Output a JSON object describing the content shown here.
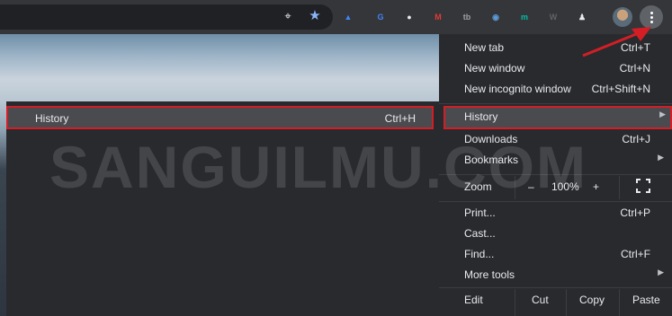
{
  "toolbar": {
    "location_icon": "location-target-icon",
    "bookmark_icon": "star-icon",
    "extensions": [
      {
        "name": "extension-arrow-up-icon",
        "glyph": "▲",
        "color": "#4285f4"
      },
      {
        "name": "extension-translate-icon",
        "glyph": "G",
        "color": "#4285f4"
      },
      {
        "name": "extension-globe-icon",
        "glyph": "●",
        "color": "#e8eaed"
      },
      {
        "name": "extension-m-red-icon",
        "glyph": "M",
        "color": "#e53935"
      },
      {
        "name": "extension-tb-icon",
        "glyph": "tb",
        "color": "#9aa0a6"
      },
      {
        "name": "extension-camera-lens-icon",
        "glyph": "◉",
        "color": "#5b9bd5"
      },
      {
        "name": "extension-m-teal-icon",
        "glyph": "m",
        "color": "#00bfa5"
      },
      {
        "name": "extension-wordpress-icon",
        "glyph": "W",
        "color": "#5f6368"
      },
      {
        "name": "extension-person-icon",
        "glyph": "♟",
        "color": "#e8eaed"
      }
    ],
    "menu_icon": "three-dots-vertical-icon"
  },
  "submenu": {
    "history_label": "History",
    "history_shortcut": "Ctrl+H"
  },
  "menu": {
    "new_tab": {
      "label": "New tab",
      "shortcut": "Ctrl+T"
    },
    "new_window": {
      "label": "New window",
      "shortcut": "Ctrl+N"
    },
    "new_incognito": {
      "label": "New incognito window",
      "shortcut": "Ctrl+Shift+N"
    },
    "history": {
      "label": "History"
    },
    "downloads": {
      "label": "Downloads",
      "shortcut": "Ctrl+J"
    },
    "bookmarks": {
      "label": "Bookmarks"
    },
    "zoom": {
      "label": "Zoom",
      "minus": "–",
      "value": "100%",
      "plus": "+",
      "fullscreen_icon": "fullscreen-icon"
    },
    "print": {
      "label": "Print...",
      "shortcut": "Ctrl+P"
    },
    "cast": {
      "label": "Cast..."
    },
    "find": {
      "label": "Find...",
      "shortcut": "Ctrl+F"
    },
    "more_tools": {
      "label": "More tools"
    },
    "edit": {
      "label": "Edit",
      "cut": "Cut",
      "copy": "Copy",
      "paste": "Paste"
    }
  },
  "watermark": "SANGUILMU.COM",
  "colors": {
    "toolbar": "#35363a",
    "menu_bg": "#292a2d",
    "highlight": "#4a4b4f",
    "annotation_red": "#d41e26"
  }
}
